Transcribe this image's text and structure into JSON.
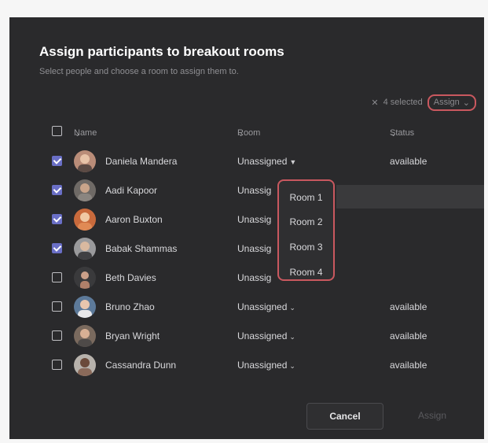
{
  "dialog": {
    "title": "Assign participants to breakout rooms",
    "subtitle": "Select people and choose a room to assign them to."
  },
  "selection": {
    "clear_icon": "x-icon",
    "count_label": "4 selected",
    "assign_label": "Assign"
  },
  "columns": {
    "name": "Name",
    "room": "Room",
    "status": "Status"
  },
  "participants": [
    {
      "name": "Daniela Mandera",
      "room": "Unassigned",
      "status": "available",
      "checked": true
    },
    {
      "name": "Aadi Kapoor",
      "room": "Unassig",
      "status": "",
      "checked": true
    },
    {
      "name": "Aaron Buxton",
      "room": "Unassig",
      "status": "",
      "checked": true
    },
    {
      "name": "Babak Shammas",
      "room": "Unassig",
      "status": "",
      "checked": true
    },
    {
      "name": "Beth Davies",
      "room": "Unassig",
      "status": "",
      "checked": false
    },
    {
      "name": "Bruno Zhao",
      "room": "Unassigned",
      "status": "available",
      "checked": false
    },
    {
      "name": "Bryan Wright",
      "room": "Unassigned",
      "status": "available",
      "checked": false
    },
    {
      "name": "Cassandra Dunn",
      "room": "Unassigned",
      "status": "available",
      "checked": false
    }
  ],
  "room_menu": {
    "items": [
      "Room 1",
      "Room 2",
      "Room 3",
      "Room 4"
    ]
  },
  "footer": {
    "cancel_label": "Cancel",
    "assign_label": "Assign"
  },
  "colors": {
    "dialog_bg": "#2a2a2c",
    "accent": "#6a6fc6",
    "highlight_outline": "#c9585f"
  }
}
